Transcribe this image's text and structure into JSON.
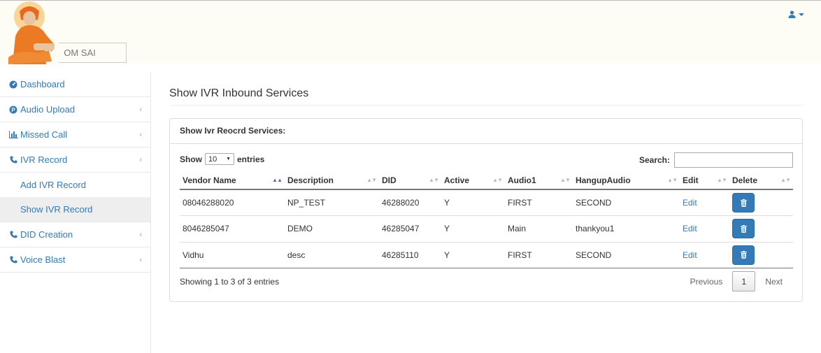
{
  "brand": {
    "name": "OM SAI"
  },
  "header": {
    "user_icon": "user-icon"
  },
  "sidebar": {
    "items": [
      {
        "label": "Dashboard",
        "icon": "dashboard-icon"
      },
      {
        "label": "Audio Upload",
        "icon": "p-circle-icon"
      },
      {
        "label": "Missed Call",
        "icon": "bar-chart-icon"
      },
      {
        "label": "IVR Record",
        "icon": "phone-icon"
      },
      {
        "label": "Add IVR Record"
      },
      {
        "label": "Show IVR Record"
      },
      {
        "label": "DID Creation",
        "icon": "phone-icon"
      },
      {
        "label": "Voice Blast",
        "icon": "phone-icon"
      }
    ]
  },
  "main": {
    "title": "Show IVR Inbound Services",
    "panel_title": "Show Ivr Reocrd Services:",
    "length": {
      "show": "Show",
      "value": "10",
      "entries": "entries"
    },
    "search_label": "Search:",
    "columns": [
      "Vendor Name",
      "Description",
      "DID",
      "Active",
      "Audio1",
      "HangupAudio",
      "Edit",
      "Delete"
    ],
    "rows": [
      {
        "vendor": "08046288020",
        "desc": "NP_TEST",
        "did": "46288020",
        "active": "Y",
        "audio1": "FIRST",
        "hangup": "SECOND",
        "edit": "Edit"
      },
      {
        "vendor": "8046285047",
        "desc": "DEMO",
        "did": "46285047",
        "active": "Y",
        "audio1": "Main",
        "hangup": "thankyou1",
        "edit": "Edit"
      },
      {
        "vendor": "Vidhu",
        "desc": "desc",
        "did": "46285110",
        "active": "Y",
        "audio1": "FIRST",
        "hangup": "SECOND",
        "edit": "Edit"
      }
    ],
    "info": "Showing 1 to 3 of 3 entries",
    "pager": {
      "previous": "Previous",
      "current": "1",
      "next": "Next"
    }
  },
  "colors": {
    "link": "#337ab7",
    "active_bg": "#eeeeee",
    "header_bg": "#fdfdf6"
  }
}
